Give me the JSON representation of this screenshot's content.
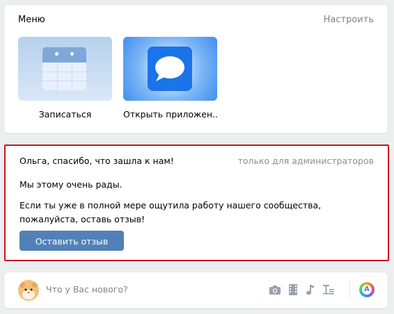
{
  "menu": {
    "title": "Меню",
    "configure": "Настроить",
    "items": [
      {
        "label": "Записаться",
        "icon": "calendar-icon"
      },
      {
        "label": "Открыть приложен...",
        "icon": "message-bubble-icon"
      }
    ]
  },
  "welcome": {
    "greeting": "Ольга, спасибо, что зашла к нам!",
    "admin_note": "только для администраторов",
    "paragraph1": "Мы этому очень рады.",
    "paragraph2": "Если ты уже в полной мере ощутила работу нашего сообщества, пожалуйста, оставь отзыв!",
    "button_label": "Оставить отзыв"
  },
  "composer": {
    "placeholder": "Что у Вас нового?",
    "icons": [
      "camera-icon",
      "video-icon",
      "music-icon",
      "text-format-icon",
      "theme-icon"
    ]
  },
  "colors": {
    "background": "#edeef0",
    "button": "#5181b8",
    "highlight_border": "#c4171e",
    "muted_text": "#828282"
  }
}
